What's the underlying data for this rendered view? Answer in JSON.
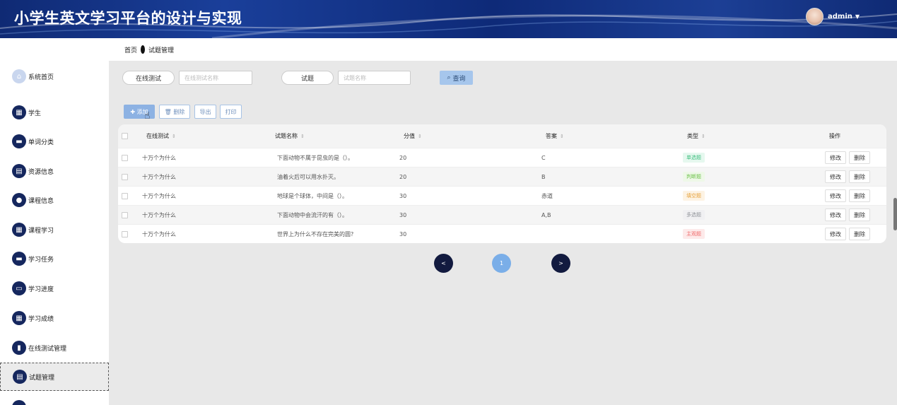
{
  "app": {
    "title": "小学生英文学习平台的设计与实现"
  },
  "user": {
    "name": "admin",
    "caret": "▼"
  },
  "breadcrumb": {
    "home": "首页",
    "current": "试题管理"
  },
  "sidebar": {
    "items": [
      {
        "label": "系统首页",
        "icon": "home-icon"
      },
      {
        "label": "学生",
        "icon": "grid-icon"
      },
      {
        "label": "单词分类",
        "icon": "briefcase-icon"
      },
      {
        "label": "资源信息",
        "icon": "clipboard-icon"
      },
      {
        "label": "课程信息",
        "icon": "user-icon"
      },
      {
        "label": "课程学习",
        "icon": "grid-icon"
      },
      {
        "label": "学习任务",
        "icon": "chat-icon"
      },
      {
        "label": "学习进度",
        "icon": "monitor-icon"
      },
      {
        "label": "学习成绩",
        "icon": "grid-icon"
      },
      {
        "label": "在线测试管理",
        "icon": "bar-chart-icon"
      },
      {
        "label": "试题管理",
        "icon": "clipboard-icon"
      }
    ]
  },
  "search": {
    "field1_label": "在线测试",
    "field1_placeholder": "在线测试名称",
    "field2_label": "试题",
    "field2_placeholder": "试题名称",
    "query_label": "查询"
  },
  "actions": {
    "add": "添加",
    "delete": "删除",
    "export": "导出",
    "print": "打印"
  },
  "table": {
    "headers": [
      "在线测试",
      "试题名称",
      "分值",
      "答案",
      "类型",
      "操作"
    ],
    "edit_label": "修改",
    "delete_label": "删除",
    "rows": [
      {
        "test": "十万个为什么",
        "question": "下面动物不属于昆虫的是（）。",
        "score": "20",
        "answer": "C",
        "type": "单选题",
        "type_color": "#3fbf7f",
        "type_bg": "#e6f8ef"
      },
      {
        "test": "十万个为什么",
        "question": "油着火后可以用水扑灭。",
        "score": "20",
        "answer": "B",
        "type": "判断题",
        "type_color": "#6cc24a",
        "type_bg": "#eef8e8"
      },
      {
        "test": "十万个为什么",
        "question": "地球是个球体，中间是（）。",
        "score": "30",
        "answer": "赤道",
        "type": "填空题",
        "type_color": "#e6a23c",
        "type_bg": "#fdf3e4"
      },
      {
        "test": "十万个为什么",
        "question": "下面动物中会流汗的有（）。",
        "score": "30",
        "answer": "A,B",
        "type": "多选题",
        "type_color": "#909399",
        "type_bg": "#f0f0f2"
      },
      {
        "test": "十万个为什么",
        "question": "世界上为什么不存在完美的圆?",
        "score": "30",
        "answer": "",
        "type": "主观题",
        "type_color": "#f06c6c",
        "type_bg": "#fdeaea"
      }
    ]
  },
  "pagination": {
    "prev": "<",
    "current": "1",
    "next": ">"
  }
}
